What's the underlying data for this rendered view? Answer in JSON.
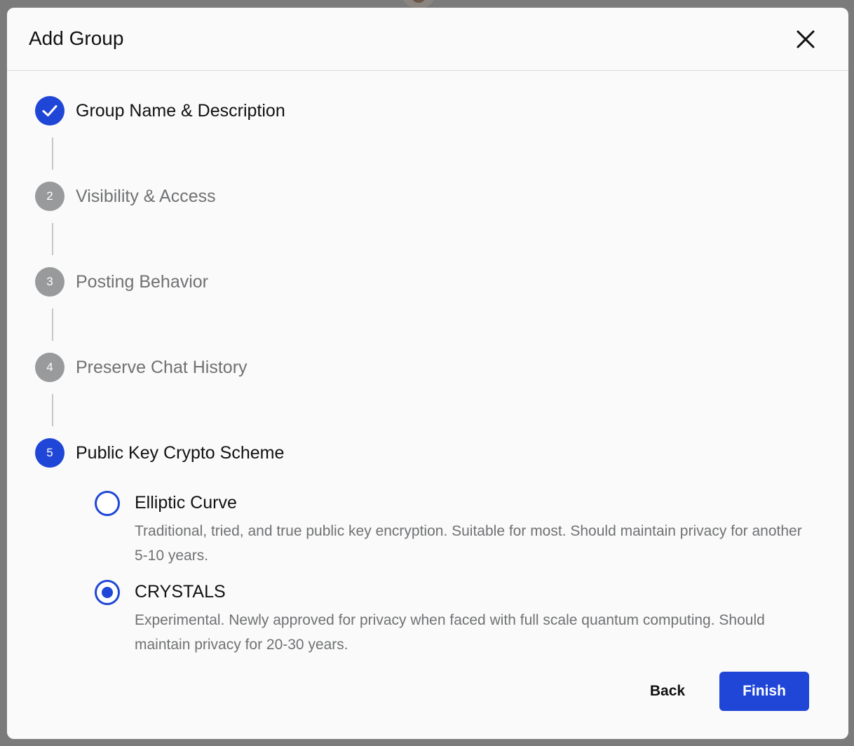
{
  "dialog": {
    "title": "Add Group",
    "close_icon": "close-icon"
  },
  "steps": [
    {
      "number": "1",
      "label": "Group Name & Description",
      "state": "completed",
      "icon": "checkmark-icon"
    },
    {
      "number": "2",
      "label": "Visibility & Access",
      "state": "pending"
    },
    {
      "number": "3",
      "label": "Posting Behavior",
      "state": "pending"
    },
    {
      "number": "4",
      "label": "Preserve Chat History",
      "state": "pending"
    },
    {
      "number": "5",
      "label": "Public Key Crypto Scheme",
      "state": "active"
    }
  ],
  "crypto_options": [
    {
      "title": "Elliptic Curve",
      "description": "Traditional, tried, and true public key encryption. Suitable for most. Should maintain privacy for another 5-10 years.",
      "selected": false
    },
    {
      "title": "CRYSTALS",
      "description": "Experimental. Newly approved for privacy when faced with full scale quantum computing. Should maintain privacy for 20-30 years.",
      "selected": true
    }
  ],
  "actions": {
    "back_label": "Back",
    "finish_label": "Finish"
  },
  "colors": {
    "accent": "#1f46d6",
    "pending_step": "#999a9b",
    "muted_text": "#707173",
    "overlay": "#7b7b7b"
  }
}
